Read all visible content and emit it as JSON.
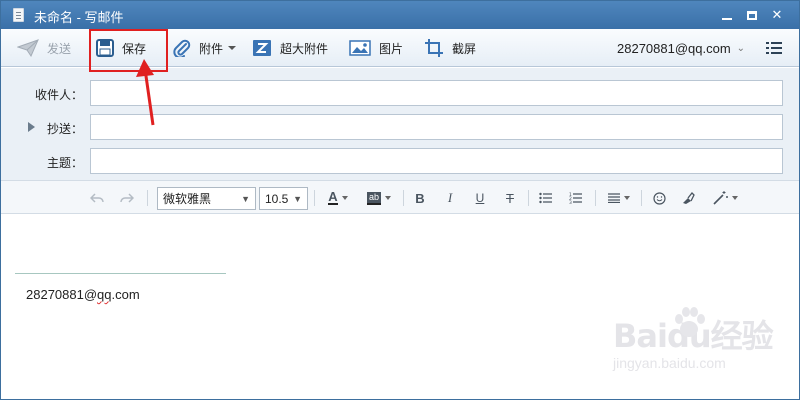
{
  "window": {
    "title": "未命名 - 写邮件"
  },
  "toolbar": {
    "send_label": "发送",
    "save_label": "保存",
    "attach_label": "附件",
    "big_attach_label": "超大附件",
    "image_label": "图片",
    "screenshot_label": "截屏",
    "account": "28270881@qq.com"
  },
  "fields": {
    "to_label": "收件人：",
    "cc_label": "抄送：",
    "subject_label": "主题：",
    "to_value": "",
    "cc_value": "",
    "subject_value": ""
  },
  "format": {
    "font_family": "微软雅黑",
    "font_size": "10.5",
    "font_color_glyph": "A",
    "highlight_glyph": "ab",
    "bold_glyph": "B",
    "italic_glyph": "I",
    "underline_glyph": "U",
    "strike_glyph": "T"
  },
  "editor": {
    "signature": "28270881@qq.com"
  },
  "watermark": {
    "brand": "Baidu经验",
    "url": "jingyan.baidu.com"
  },
  "colors": {
    "titlebar": "#3f76ad",
    "highlight_box": "#e02020",
    "arrow": "#e02020"
  },
  "icons": [
    "doc-icon",
    "send-icon",
    "save-icon",
    "paperclip-icon",
    "big-attachment-icon",
    "image-icon",
    "screenshot-icon",
    "menu-icon",
    "undo-icon",
    "redo-icon",
    "bullet-list-icon",
    "numbered-list-icon",
    "align-icon",
    "emoji-icon",
    "paint-icon",
    "magic-wand-icon"
  ]
}
